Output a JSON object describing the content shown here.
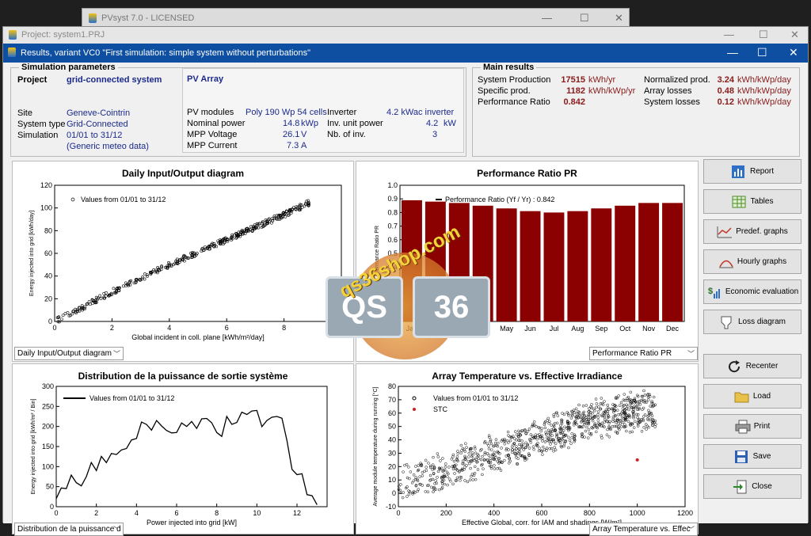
{
  "bg_window": {
    "title": "PVsyst 7.0 - LICENSED"
  },
  "project_window": {
    "title": "Project:  system1.PRJ"
  },
  "results_window": {
    "title": "Results, variant VC0  \"First simulation: simple system without perturbations\""
  },
  "sim_params": {
    "group_title": "Simulation parameters",
    "project_label": "Project",
    "project_value": "grid-connected system",
    "site_label": "Site",
    "site_value": "Geneve-Cointrin",
    "system_type_label": "System type",
    "system_type_value": "Grid-Connected",
    "simulation_label": "Simulation",
    "simulation_value": "01/01 to 31/12",
    "meteo": "(Generic meteo data)",
    "pv_array_title": "PV Array",
    "pv_modules_label": "PV modules",
    "pv_modules_value": "Poly 190 Wp  54 cells",
    "nominal_power_label": "Nominal power",
    "nominal_power_value": "14.8",
    "nominal_power_unit": "kWp",
    "mpp_voltage_label": "MPP Voltage",
    "mpp_voltage_value": "26.1",
    "mpp_voltage_unit": "V",
    "mpp_current_label": "MPP Current",
    "mpp_current_value": "7.3",
    "mpp_current_unit": "A",
    "inverter_label": "Inverter",
    "inverter_value": "4.2 kWac inverter",
    "inv_unit_power_label": "Inv. unit power",
    "inv_unit_power_value": "4.2",
    "inv_unit_power_unit": "kW",
    "nb_inv_label": "Nb. of inv.",
    "nb_inv_value": "3"
  },
  "main_results": {
    "group_title": "Main results",
    "rows_left": [
      {
        "label": "System Production",
        "value": "17515",
        "unit": "kWh/yr"
      },
      {
        "label": "Specific prod.",
        "value": "1182",
        "unit": "kWh/kWp/yr"
      },
      {
        "label": "Performance Ratio",
        "value": "0.842",
        "unit": ""
      }
    ],
    "rows_right": [
      {
        "label": "Normalized prod.",
        "value": "3.24",
        "unit": "kWh/kWp/day"
      },
      {
        "label": "Array losses",
        "value": "0.48",
        "unit": "kWh/kWp/day"
      },
      {
        "label": "System losses",
        "value": "0.12",
        "unit": "kWh/kWp/day"
      }
    ]
  },
  "panel_io": {
    "title": "Daily Input/Output diagram",
    "select": "Daily Input/Output diagram",
    "legend": "Values from 01/01 to 31/12",
    "xlabel": "Global incident in coll. plane [kWh/m²/day]",
    "ylabel": "Energy injected into grid [kWh/day]",
    "x_ticks": [
      "0",
      "2",
      "4",
      "6",
      "8",
      "10"
    ],
    "y_ticks": [
      "0",
      "20",
      "40",
      "60",
      "80",
      "100",
      "120"
    ]
  },
  "panel_pr": {
    "title": "Performance Ratio PR",
    "select": "Performance Ratio PR",
    "legend": "Performance Ratio (Yf / Yr) :  0.842",
    "ylabel": "Performance Ratio PR",
    "y_ticks": [
      "0.0",
      "0.1",
      "0.2",
      "0.3",
      "0.4",
      "0.5",
      "0.6",
      "0.7",
      "0.8",
      "0.9",
      "1.0"
    ]
  },
  "panel_dist": {
    "title": "Distribution de la puissance de sortie système",
    "select": "Distribution de la puissance d",
    "legend": "Values from 01/01 to 31/12",
    "xlabel": "Power injected into grid [kW]",
    "ylabel": "Energy injected into grid [kWh/m² / Bin]",
    "x_ticks": [
      "0",
      "2",
      "4",
      "6",
      "8",
      "10",
      "12"
    ],
    "y_ticks": [
      "0",
      "50",
      "100",
      "150",
      "200",
      "250",
      "300"
    ]
  },
  "panel_temp": {
    "title": "Array Temperature vs. Effective Irradiance",
    "select": "Array Temperature vs. Effec",
    "legend_values": "Values from 01/01 to 31/12",
    "legend_stc": "STC",
    "xlabel": "Effective Global, corr. for IAM and shadings [W/m²]",
    "ylabel": "Average module temperature during running [°C]",
    "x_ticks": [
      "0",
      "200",
      "400",
      "600",
      "800",
      "1000",
      "1200"
    ],
    "y_ticks": [
      "-10",
      "0",
      "10",
      "20",
      "30",
      "40",
      "50",
      "60",
      "70",
      "80"
    ]
  },
  "buttons": {
    "report": "Report",
    "tables": "Tables",
    "predef": "Predef. graphs",
    "hourly": "Hourly graphs",
    "economic": "Economic evaluation",
    "loss": "Loss diagram",
    "recenter": "Recenter",
    "load": "Load",
    "print": "Print",
    "save": "Save",
    "close": "Close"
  },
  "watermark": {
    "text": "qs36shop.com",
    "left": "QS",
    "right": "36"
  },
  "colors": {
    "title_bar": "#0e4fa1",
    "pr_bar": "#8b0000",
    "value_red": "#8a1b1b",
    "label_blue": "#1b2a8c",
    "stc_marker": "#cc2222"
  },
  "chart_data": [
    {
      "type": "scatter",
      "title": "Daily Input/Output diagram",
      "xlabel": "Global incident in coll. plane [kWh/m²/day]",
      "ylabel": "Energy injected into grid [kWh/day]",
      "xlim": [
        0,
        10
      ],
      "ylim": [
        0,
        120
      ],
      "series": [
        {
          "name": "Values from 01/01 to 31/12",
          "trend": [
            [
              0,
              0
            ],
            [
              1,
              13
            ],
            [
              2,
              26
            ],
            [
              3,
              38
            ],
            [
              4,
              50
            ],
            [
              5,
              61
            ],
            [
              6,
              72
            ],
            [
              7,
              83
            ],
            [
              8,
              94
            ],
            [
              9,
              106
            ]
          ],
          "x_range": [
            0.1,
            8.9
          ]
        }
      ]
    },
    {
      "type": "bar",
      "title": "Performance Ratio PR",
      "ylabel": "Performance Ratio PR",
      "ylim": [
        0,
        1.0
      ],
      "categories": [
        "Jan",
        "Feb",
        "Mar",
        "Apr",
        "May",
        "Jun",
        "Jul",
        "Aug",
        "Sep",
        "Oct",
        "Nov",
        "Dec"
      ],
      "values": [
        0.89,
        0.88,
        0.87,
        0.85,
        0.83,
        0.81,
        0.8,
        0.81,
        0.83,
        0.85,
        0.87,
        0.87
      ]
    },
    {
      "type": "line",
      "title": "Distribution de la puissance de sortie système",
      "xlabel": "Power injected into grid [kW]",
      "ylabel": "Energy injected into grid [kWh/m² / Bin]",
      "xlim": [
        0,
        13.5
      ],
      "ylim": [
        0,
        300
      ],
      "series": [
        {
          "name": "Values from 01/01 to 31/12",
          "x": [
            0,
            0.5,
            1,
            1.5,
            2,
            2.5,
            3,
            3.5,
            4,
            4.5,
            5,
            5.5,
            6,
            6.5,
            7,
            7.5,
            8,
            8.5,
            9,
            9.5,
            10,
            10.5,
            11,
            11.5,
            12,
            12.5,
            13
          ],
          "y": [
            20,
            45,
            60,
            75,
            90,
            110,
            130,
            145,
            170,
            205,
            215,
            190,
            185,
            200,
            195,
            220,
            185,
            225,
            210,
            230,
            240,
            215,
            225,
            165,
            80,
            30,
            5
          ]
        }
      ]
    },
    {
      "type": "scatter",
      "title": "Array Temperature vs. Effective Irradiance",
      "xlabel": "Effective Global, corr. for IAM and shadings [W/m²]",
      "ylabel": "Average module temperature during running [°C]",
      "xlim": [
        0,
        1200
      ],
      "ylim": [
        -10,
        80
      ],
      "series": [
        {
          "name": "Values from 01/01 to 31/12",
          "trend": [
            [
              0,
              5
            ],
            [
              200,
              18
            ],
            [
              400,
              30
            ],
            [
              600,
              42
            ],
            [
              800,
              54
            ],
            [
              1000,
              62
            ]
          ],
          "spread": 12
        },
        {
          "name": "STC",
          "points": [
            [
              1000,
              25
            ]
          ]
        }
      ]
    }
  ]
}
